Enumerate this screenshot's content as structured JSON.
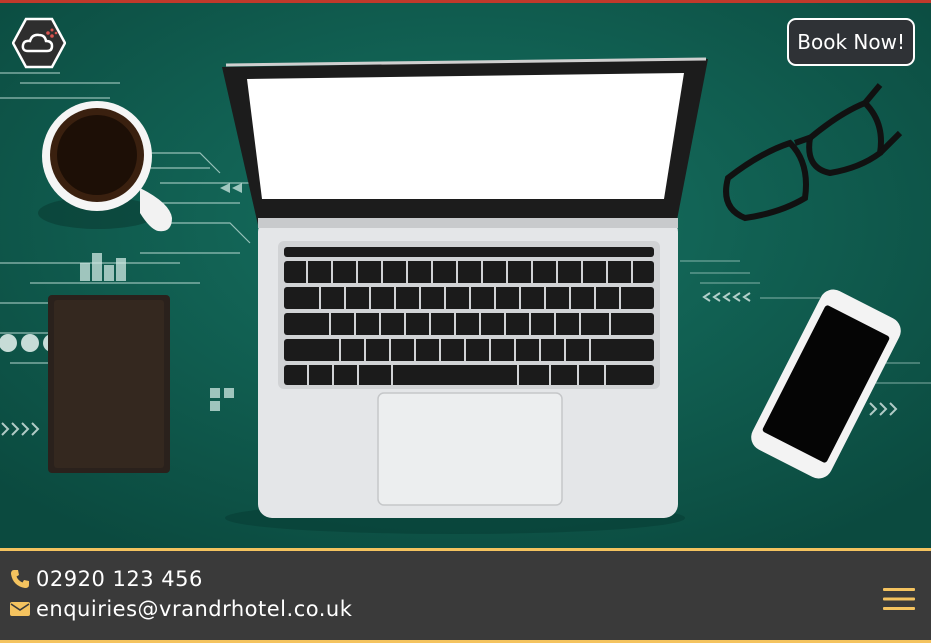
{
  "header": {
    "book_label": "Book Now!"
  },
  "footer": {
    "phone": "02920 123 456",
    "email": "enquiries@vrandrhotel.co.uk"
  },
  "colors": {
    "accent": "#f4c35f",
    "hero_bg": "#0f5a4c",
    "footer_bg": "#3a3a3a"
  }
}
